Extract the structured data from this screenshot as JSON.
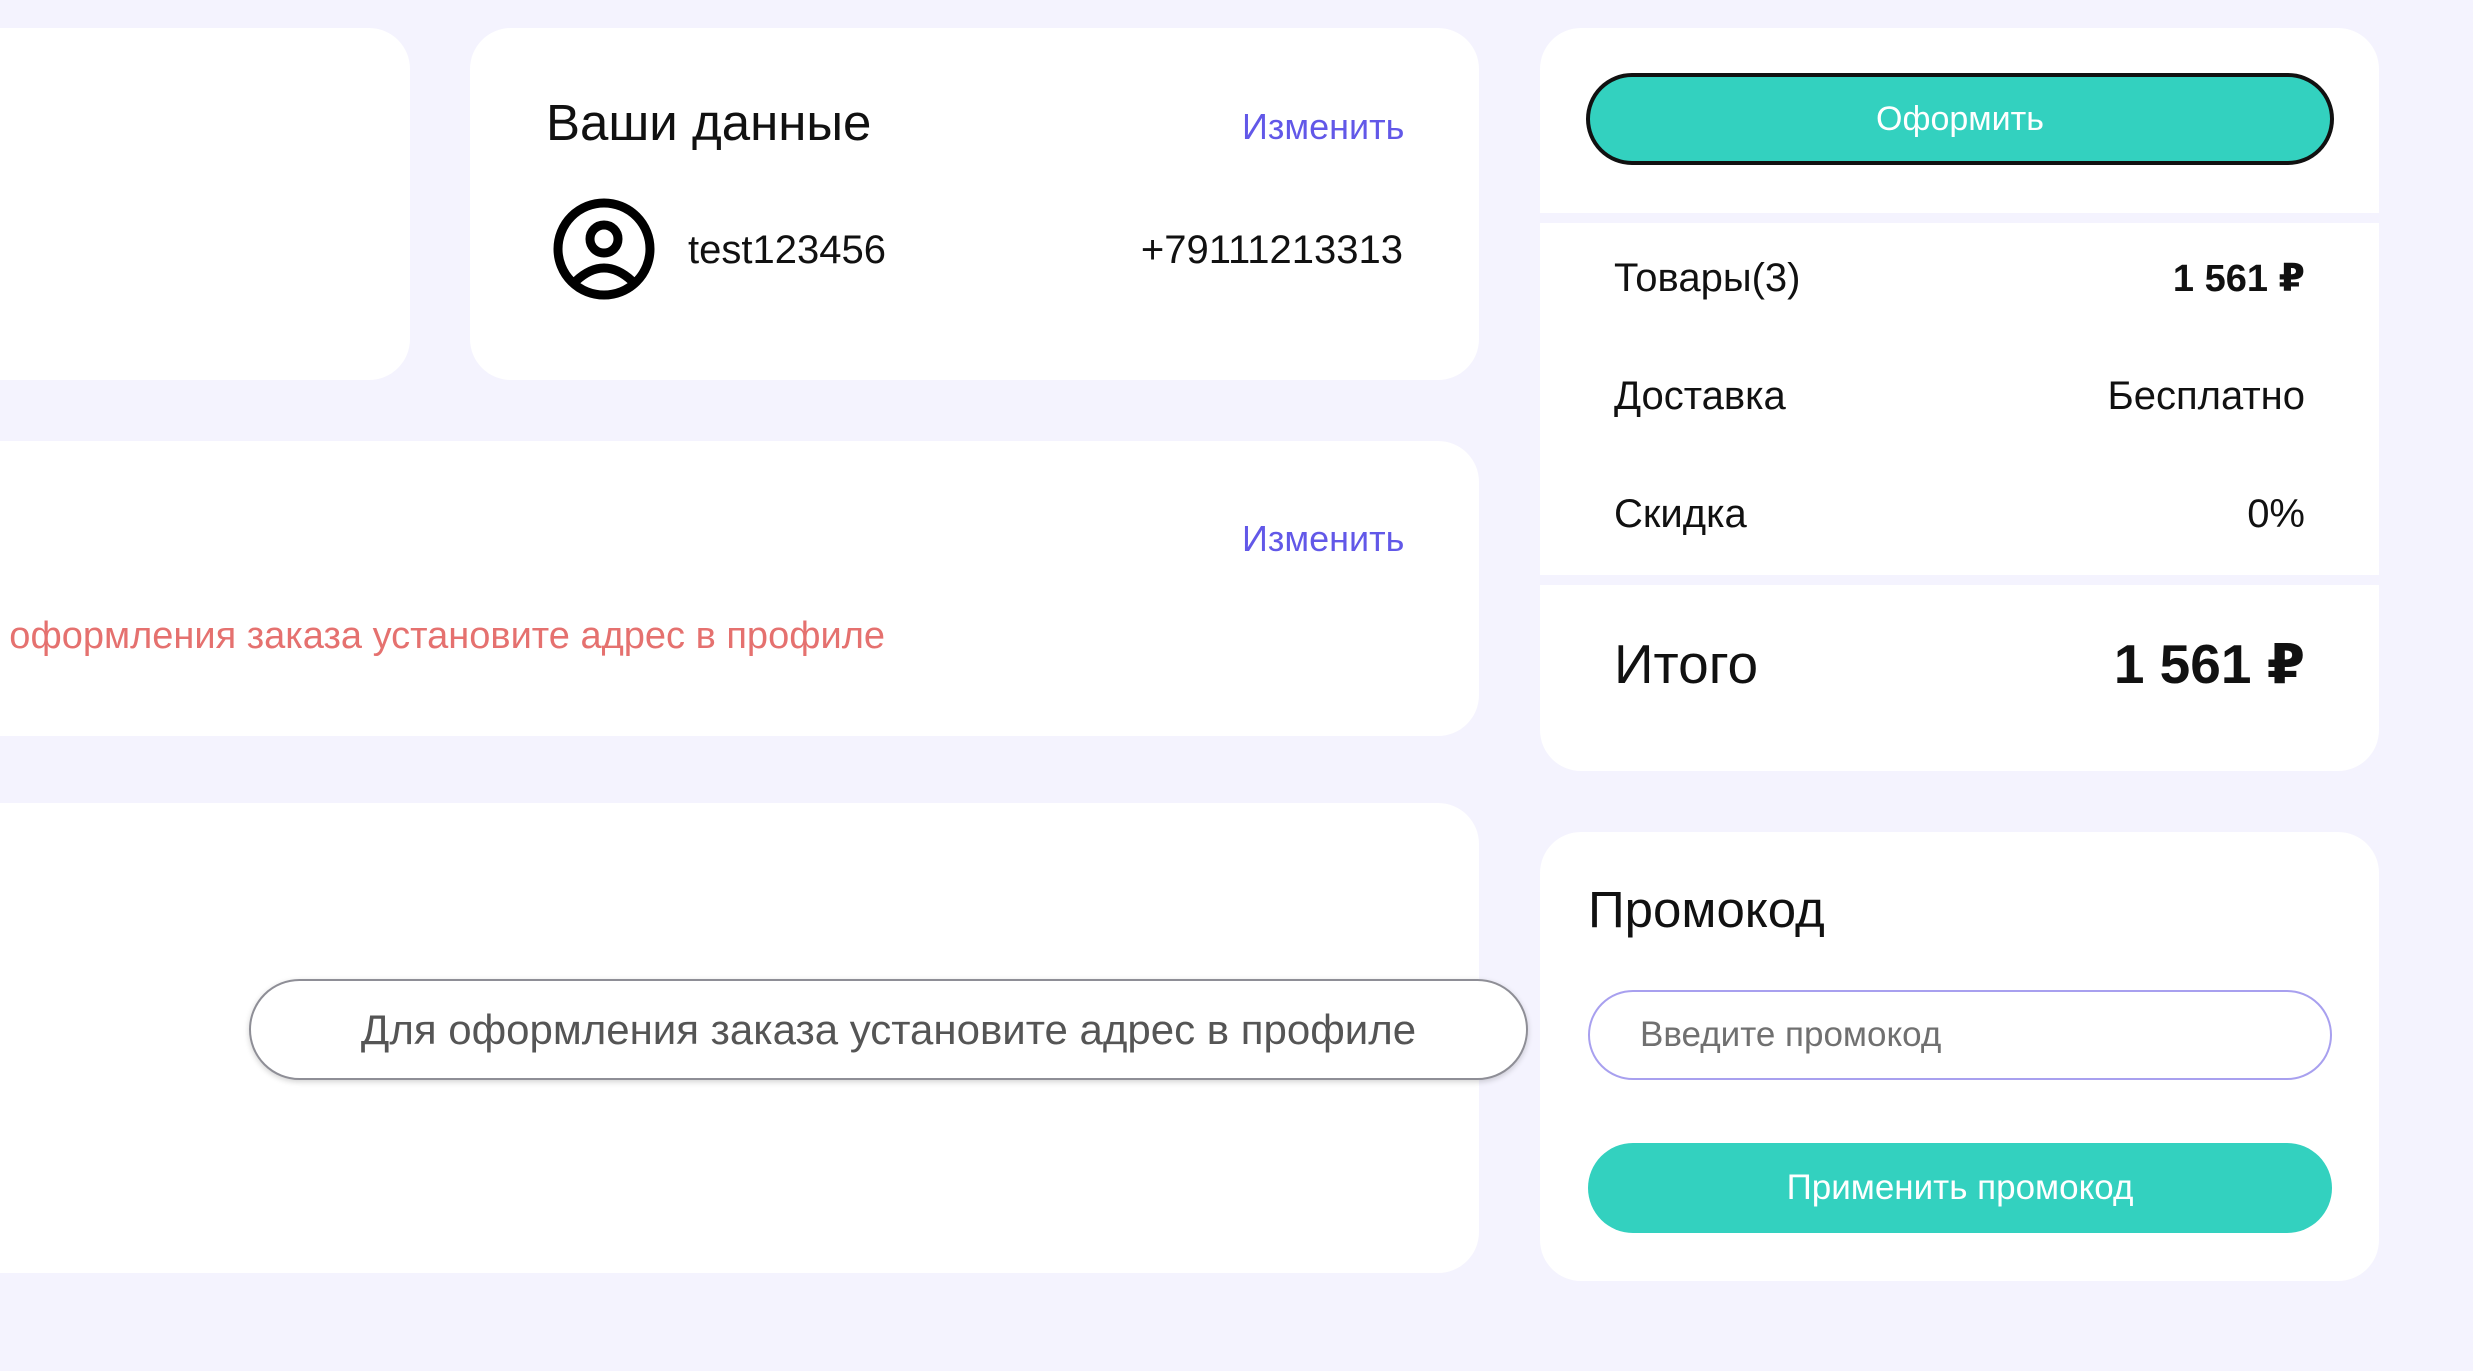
{
  "user_card": {
    "title": "Ваши данные",
    "edit_label": "Изменить",
    "username": "test123456",
    "phone": "+79111213313"
  },
  "address_card": {
    "edit_label": "Изменить",
    "warning": "Для оформления заказа установите адрес в профиле"
  },
  "tooltip": {
    "text": "Для оформления заказа установите адрес в профиле"
  },
  "summary": {
    "checkout_label": "Оформить",
    "goods_label": "Товары(3)",
    "goods_value": "1 561 ₽",
    "delivery_label": "Доставка",
    "delivery_value": "Бесплатно",
    "discount_label": "Скидка",
    "discount_value": "0%",
    "total_label": "Итого",
    "total_value": "1 561 ₽"
  },
  "promo": {
    "title": "Промокод",
    "input_placeholder": "Введите промокод",
    "input_value": "",
    "apply_label": "Применить промокод"
  },
  "colors": {
    "accent": "#33d1bf",
    "link": "#6258e8",
    "warning": "#e5716f",
    "background": "#f4f3fe"
  },
  "icons": {
    "avatar": "user-circle-icon"
  }
}
